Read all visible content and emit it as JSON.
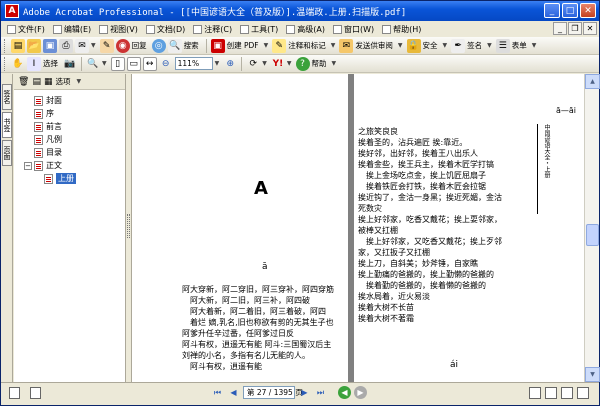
{
  "window": {
    "title": "Adobe Acrobat Professional - [[中国谚语大全（普及版）].温端政.上册.扫描版.pdf]"
  },
  "menu": {
    "items": [
      "文件(F)",
      "编辑(E)",
      "视图(V)",
      "文档(D)",
      "注释(C)",
      "工具(T)",
      "高级(A)",
      "窗口(W)",
      "帮助(H)"
    ]
  },
  "toolbar1": {
    "email": "回复",
    "search": "搜索",
    "create_pdf": "创建 PDF",
    "comment": "注释和标记",
    "send_review": "发送供审阅",
    "security": "安全",
    "sign": "签名",
    "forms": "表单"
  },
  "toolbar2": {
    "select": "选择",
    "zoom": "111%",
    "help": "帮助"
  },
  "nav_tabs": [
    "签名",
    "书签",
    "页面"
  ],
  "bookmarks": {
    "options": "选项",
    "items": [
      {
        "label": "封面"
      },
      {
        "label": "序"
      },
      {
        "label": "前言"
      },
      {
        "label": "凡例"
      },
      {
        "label": "目录"
      },
      {
        "label": "正文"
      },
      {
        "label": "上册"
      }
    ]
  },
  "page_left": {
    "big_letter": "A",
    "sub_letter": "ā",
    "lines": [
      "阿大穿新，阿二穿旧，阿三穿补，阿四穿筋",
      "阿大新，阿二旧，阿三补，阿四破",
      "阿大着新，阿二着旧，阿三着破，阿四",
      "着烂  嫡,乳名,旧也称欲有剪的无其生子也",
      "阿爹升任辛过番，任阿爹过日反",
      "阿斗有权，逍遥无有能  阿斗:三国蜀汉后主",
      "刘禅的小名，多指有名儿无能的人。",
      "阿斗有权，逍遥有能"
    ]
  },
  "page_right": {
    "header": "ā—āi",
    "side_text": "中国谚语大全・上册",
    "lines": [
      "之旅笑良良",
      "挨着圣的，沾兵遍匠  挨:靠近。",
      "挨好邻，出好邻，挨着王八出乐人",
      "挨着金些，挨王兵主，挨着木匠学打镐",
      "挨上金场吃点金，挨上饥匠屈扇子",
      "挨着铁匠会打铁，挨着木匠会拉锯",
      "挨近钩了，金沽一身黑；挨近死媚，金沽",
      "死数灾",
      "挨上好邻家，吃香又戴花；挨上耍邻家，",
      "被棒又扛棚",
      "挨上好邻家，又吃香又戴花；挨上歹邻",
      "家，又扛扳子又扛棚",
      "挨上刀，自斜美；妙斧锤，自家瞧",
      "挨上勤痛的爸搬的，挨上勤懒的爸搬的",
      "挨着勤的爸搬的，挨着懒的爸搬的",
      "挨水局着，近火易淡",
      "挨着大树不长苗",
      "挨着大树不著霜"
    ],
    "footer": "ái"
  },
  "status": {
    "page_display": "第 27 / 1395 页"
  }
}
